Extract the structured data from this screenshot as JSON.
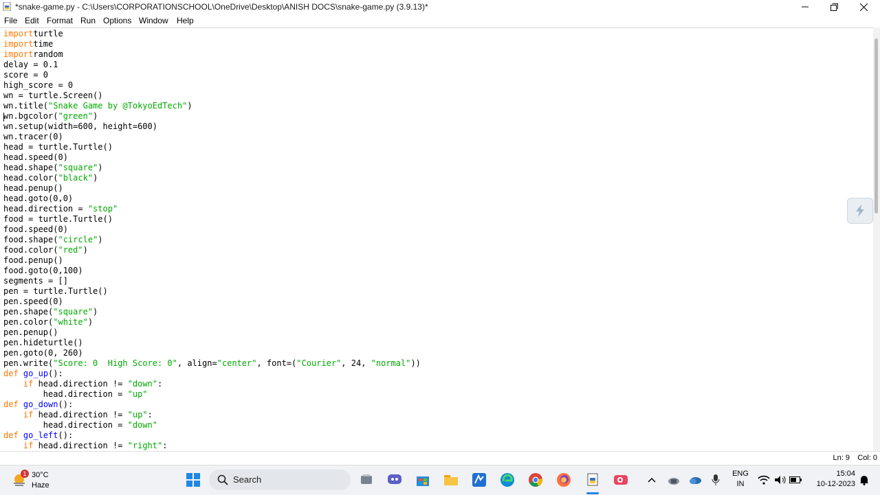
{
  "window": {
    "title": "*snake-game.py - C:\\Users\\CORPORATIONSCHOOL\\OneDrive\\Desktop\\ANISH DOCS\\snake-game.py (3.9.13)*"
  },
  "menu": [
    "File",
    "Edit",
    "Format",
    "Run",
    "Options",
    "Window",
    "Help"
  ],
  "code_lines": [
    [
      [
        "kw",
        "import"
      ],
      [
        "",
        "turtle"
      ]
    ],
    [
      [
        "kw",
        "import"
      ],
      [
        "",
        "time"
      ]
    ],
    [
      [
        "kw",
        "import"
      ],
      [
        "",
        "random"
      ]
    ],
    [
      [
        "",
        "delay = 0.1"
      ]
    ],
    [
      [
        "",
        "score = 0"
      ]
    ],
    [
      [
        "",
        "high_score = 0"
      ]
    ],
    [
      [
        "",
        "wn = turtle.Screen()"
      ]
    ],
    [
      [
        "",
        "wn.title("
      ],
      [
        "str",
        "\"Snake Game by @TokyoEdTech\""
      ],
      [
        "",
        ")"
      ]
    ],
    [
      [
        "",
        "wn.bgcolor("
      ],
      [
        "str",
        "\"green\""
      ],
      [
        "",
        ")"
      ]
    ],
    [
      [
        "",
        "wn.setup(width=600, height=600)"
      ]
    ],
    [
      [
        "",
        "wn.tracer(0)"
      ]
    ],
    [
      [
        "",
        "head = turtle.Turtle()"
      ]
    ],
    [
      [
        "",
        "head.speed(0)"
      ]
    ],
    [
      [
        "",
        "head.shape("
      ],
      [
        "str",
        "\"square\""
      ],
      [
        "",
        ")"
      ]
    ],
    [
      [
        "",
        "head.color("
      ],
      [
        "str",
        "\"black\""
      ],
      [
        "",
        ")"
      ]
    ],
    [
      [
        "",
        "head.penup()"
      ]
    ],
    [
      [
        "",
        "head.goto(0,0)"
      ]
    ],
    [
      [
        "",
        "head.direction = "
      ],
      [
        "str",
        "\"stop\""
      ]
    ],
    [
      [
        "",
        "food = turtle.Turtle()"
      ]
    ],
    [
      [
        "",
        "food.speed(0)"
      ]
    ],
    [
      [
        "",
        "food.shape("
      ],
      [
        "str",
        "\"circle\""
      ],
      [
        "",
        ")"
      ]
    ],
    [
      [
        "",
        "food.color("
      ],
      [
        "str",
        "\"red\""
      ],
      [
        "",
        ")"
      ]
    ],
    [
      [
        "",
        "food.penup()"
      ]
    ],
    [
      [
        "",
        "food.goto(0,100)"
      ]
    ],
    [
      [
        "",
        "segments = []"
      ]
    ],
    [
      [
        "",
        "pen = turtle.Turtle()"
      ]
    ],
    [
      [
        "",
        "pen.speed(0)"
      ]
    ],
    [
      [
        "",
        "pen.shape("
      ],
      [
        "str",
        "\"square\""
      ],
      [
        "",
        ")"
      ]
    ],
    [
      [
        "",
        "pen.color("
      ],
      [
        "str",
        "\"white\""
      ],
      [
        "",
        ")"
      ]
    ],
    [
      [
        "",
        "pen.penup()"
      ]
    ],
    [
      [
        "",
        "pen.hideturtle()"
      ]
    ],
    [
      [
        "",
        "pen.goto(0, 260)"
      ]
    ],
    [
      [
        "",
        "pen.write("
      ],
      [
        "str",
        "\"Score: 0  High Score: 0\""
      ],
      [
        "",
        ", align="
      ],
      [
        "str",
        "\"center\""
      ],
      [
        "",
        ", font=("
      ],
      [
        "str",
        "\"Courier\""
      ],
      [
        "",
        ", 24, "
      ],
      [
        "str",
        "\"normal\""
      ],
      [
        "",
        "))"
      ]
    ],
    [
      [
        "kw",
        "def"
      ],
      [
        "",
        " "
      ],
      [
        "def",
        "go_up"
      ],
      [
        "",
        "():"
      ]
    ],
    [
      [
        "",
        "    "
      ],
      [
        "kw",
        "if"
      ],
      [
        "",
        " head.direction != "
      ],
      [
        "str",
        "\"down\""
      ],
      [
        "",
        ":"
      ]
    ],
    [
      [
        "",
        "        head.direction = "
      ],
      [
        "str",
        "\"up\""
      ]
    ],
    [
      [
        "kw",
        "def"
      ],
      [
        "",
        " "
      ],
      [
        "def",
        "go_down"
      ],
      [
        "",
        "():"
      ]
    ],
    [
      [
        "",
        "    "
      ],
      [
        "kw",
        "if"
      ],
      [
        "",
        " head.direction != "
      ],
      [
        "str",
        "\"up\""
      ],
      [
        "",
        ":"
      ]
    ],
    [
      [
        "",
        "        head.direction = "
      ],
      [
        "str",
        "\"down\""
      ]
    ],
    [
      [
        "kw",
        "def"
      ],
      [
        "",
        " "
      ],
      [
        "def",
        "go_left"
      ],
      [
        "",
        "():"
      ]
    ],
    [
      [
        "",
        "    "
      ],
      [
        "kw",
        "if"
      ],
      [
        "",
        " head.direction != "
      ],
      [
        "str",
        "\"right\""
      ],
      [
        "",
        ":"
      ]
    ]
  ],
  "status": {
    "line": "Ln: 9",
    "col": "Col: 0"
  },
  "taskbar": {
    "weather_temp": "30°C",
    "weather_cond": "Haze",
    "weather_badge": "1",
    "search_label": "Search",
    "lang_top": "ENG",
    "lang_bottom": "IN",
    "time": "15:04",
    "date": "10-12-2023"
  },
  "icons": [
    "python-file-icon",
    "minimize-icon",
    "maximize-icon",
    "close-icon",
    "windows-start-icon",
    "search-icon",
    "task-view-icon",
    "teams-chat-icon",
    "store-icon",
    "file-explorer-icon",
    "vscode-icon",
    "edge-icon",
    "chrome-icon",
    "firefox-icon",
    "idle-app-icon",
    "recorder-icon",
    "chevron-up-icon",
    "network-icon",
    "cloud-icon",
    "microphone-icon",
    "wifi-icon",
    "volume-icon",
    "battery-icon",
    "notification-bell-icon"
  ]
}
